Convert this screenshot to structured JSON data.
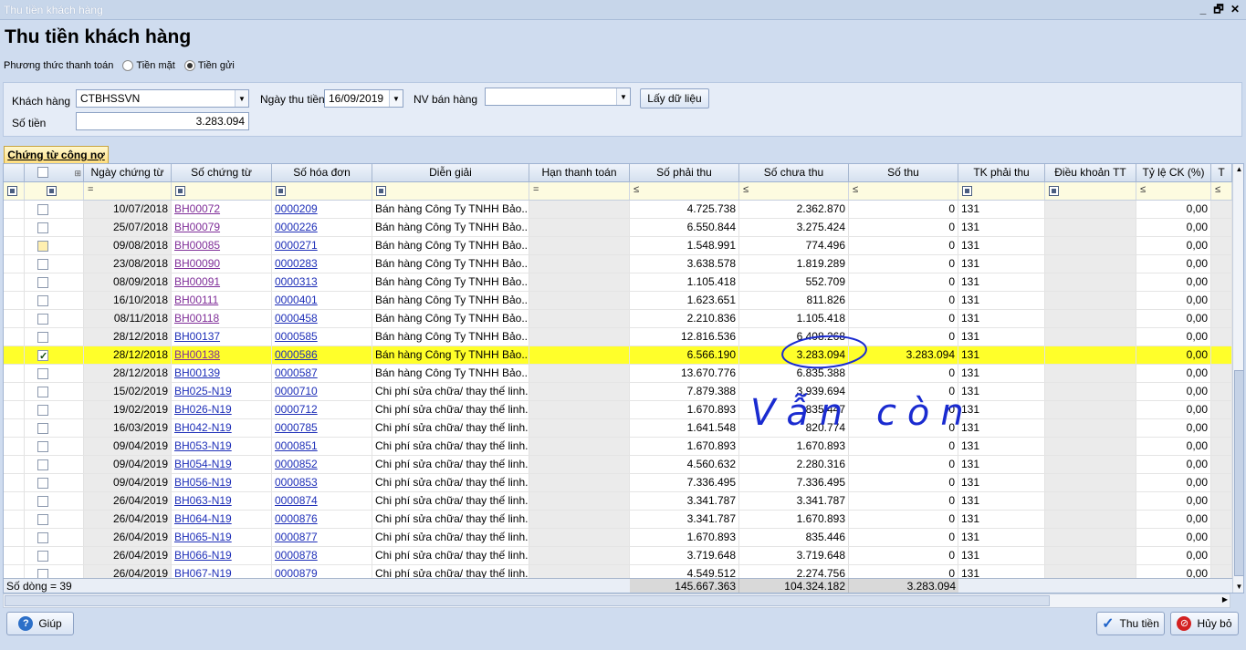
{
  "window": {
    "title": "Thu tiền khách hàng",
    "minimize": "_",
    "restore": "🗗",
    "close": "✕"
  },
  "page_title": "Thu tiền khách hàng",
  "payment": {
    "label": "Phương thức thanh toán",
    "opt_cash": "Tiền mặt",
    "opt_bank": "Tiền gửi",
    "selected": "Tiền gửi"
  },
  "filter": {
    "customer_label": "Khách hàng",
    "customer_value": "CTBHSSVN",
    "date_label": "Ngày thu tiền",
    "date_value": "16/09/2019",
    "staff_label": "NV bán hàng",
    "staff_value": "",
    "get_button": "Lấy dữ liệu",
    "amount_label": "Số tiền",
    "amount_value": "3.283.094"
  },
  "tab": "Chứng từ công nợ",
  "columns": [
    "Ngày chứng từ",
    "Số chứng từ",
    "Số hóa đơn",
    "Diễn giải",
    "Hạn thanh toán",
    "Số phải thu",
    "Số chưa thu",
    "Số thu",
    "TK phải thu",
    "Điều khoản TT",
    "Tỷ lệ CK (%)",
    "T"
  ],
  "filter_ops": {
    "eq": "=",
    "le": "≤"
  },
  "rows": [
    {
      "date": "10/07/2018",
      "doc": "BH00072",
      "inv": "0000209",
      "desc": "Bán hàng Công Ty TNHH Bảo...",
      "due": "4.725.738",
      "unpaid": "2.362.870",
      "paid": "0",
      "acc": "131",
      "rate": "0,00",
      "checked": false,
      "sel": false,
      "visited": true
    },
    {
      "date": "25/07/2018",
      "doc": "BH00079",
      "inv": "0000226",
      "desc": "Bán hàng Công Ty TNHH Bảo...",
      "due": "6.550.844",
      "unpaid": "3.275.424",
      "paid": "0",
      "acc": "131",
      "rate": "0,00",
      "checked": false,
      "sel": false,
      "visited": true
    },
    {
      "date": "09/08/2018",
      "doc": "BH00085",
      "inv": "0000271",
      "desc": "Bán hàng Công Ty TNHH Bảo...",
      "due": "1.548.991",
      "unpaid": "774.496",
      "paid": "0",
      "acc": "131",
      "rate": "0,00",
      "checked": false,
      "sel": false,
      "visited": true,
      "cb_yellow": true
    },
    {
      "date": "23/08/2018",
      "doc": "BH00090",
      "inv": "0000283",
      "desc": "Bán hàng Công Ty TNHH Bảo...",
      "due": "3.638.578",
      "unpaid": "1.819.289",
      "paid": "0",
      "acc": "131",
      "rate": "0,00",
      "checked": false,
      "sel": false,
      "visited": true
    },
    {
      "date": "08/09/2018",
      "doc": "BH00091",
      "inv": "0000313",
      "desc": "Bán hàng Công Ty TNHH Bảo...",
      "due": "1.105.418",
      "unpaid": "552.709",
      "paid": "0",
      "acc": "131",
      "rate": "0,00",
      "checked": false,
      "sel": false,
      "visited": true
    },
    {
      "date": "16/10/2018",
      "doc": "BH00111",
      "inv": "0000401",
      "desc": "Bán hàng Công Ty TNHH Bảo...",
      "due": "1.623.651",
      "unpaid": "811.826",
      "paid": "0",
      "acc": "131",
      "rate": "0,00",
      "checked": false,
      "sel": false,
      "visited": true
    },
    {
      "date": "08/11/2018",
      "doc": "BH00118",
      "inv": "0000458",
      "desc": "Bán hàng Công Ty TNHH Bảo...",
      "due": "2.210.836",
      "unpaid": "1.105.418",
      "paid": "0",
      "acc": "131",
      "rate": "0,00",
      "checked": false,
      "sel": false,
      "visited": true
    },
    {
      "date": "28/12/2018",
      "doc": "BH00137",
      "inv": "0000585",
      "desc": "Bán hàng Công Ty TNHH Bảo...",
      "due": "12.816.536",
      "unpaid": "6.408.268",
      "paid": "0",
      "acc": "131",
      "rate": "0,00",
      "checked": false,
      "sel": false,
      "visited": false
    },
    {
      "date": "28/12/2018",
      "doc": "BH00138",
      "inv": "0000586",
      "desc": "Bán hàng Công Ty TNHH Bảo...",
      "due": "6.566.190",
      "unpaid": "3.283.094",
      "paid": "3.283.094",
      "acc": "131",
      "rate": "0,00",
      "checked": true,
      "sel": true,
      "visited": true
    },
    {
      "date": "28/12/2018",
      "doc": "BH00139",
      "inv": "0000587",
      "desc": "Bán hàng Công Ty TNHH Bảo...",
      "due": "13.670.776",
      "unpaid": "6.835.388",
      "paid": "0",
      "acc": "131",
      "rate": "0,00",
      "checked": false,
      "sel": false,
      "visited": false
    },
    {
      "date": "15/02/2019",
      "doc": "BH025-N19",
      "inv": "0000710",
      "desc": "Chi phí sửa chữa/ thay thế linh...",
      "due": "7.879.388",
      "unpaid": "3.939.694",
      "paid": "0",
      "acc": "131",
      "rate": "0,00",
      "checked": false,
      "sel": false,
      "visited": false
    },
    {
      "date": "19/02/2019",
      "doc": "BH026-N19",
      "inv": "0000712",
      "desc": "Chi phí sửa chữa/ thay thế linh...",
      "due": "1.670.893",
      "unpaid": "835.447",
      "paid": "0",
      "acc": "131",
      "rate": "0,00",
      "checked": false,
      "sel": false,
      "visited": false
    },
    {
      "date": "16/03/2019",
      "doc": "BH042-N19",
      "inv": "0000785",
      "desc": "Chi phí sửa chữa/ thay thế linh...",
      "due": "1.641.548",
      "unpaid": "820.774",
      "paid": "0",
      "acc": "131",
      "rate": "0,00",
      "checked": false,
      "sel": false,
      "visited": false
    },
    {
      "date": "09/04/2019",
      "doc": "BH053-N19",
      "inv": "0000851",
      "desc": "Chi phí sửa chữa/ thay thế linh...",
      "due": "1.670.893",
      "unpaid": "1.670.893",
      "paid": "0",
      "acc": "131",
      "rate": "0,00",
      "checked": false,
      "sel": false,
      "visited": false
    },
    {
      "date": "09/04/2019",
      "doc": "BH054-N19",
      "inv": "0000852",
      "desc": "Chi phí sửa chữa/ thay thế linh...",
      "due": "4.560.632",
      "unpaid": "2.280.316",
      "paid": "0",
      "acc": "131",
      "rate": "0,00",
      "checked": false,
      "sel": false,
      "visited": false
    },
    {
      "date": "09/04/2019",
      "doc": "BH056-N19",
      "inv": "0000853",
      "desc": "Chi phí sửa chữa/ thay thế linh...",
      "due": "7.336.495",
      "unpaid": "7.336.495",
      "paid": "0",
      "acc": "131",
      "rate": "0,00",
      "checked": false,
      "sel": false,
      "visited": false
    },
    {
      "date": "26/04/2019",
      "doc": "BH063-N19",
      "inv": "0000874",
      "desc": "Chi phí sửa chữa/ thay thế linh...",
      "due": "3.341.787",
      "unpaid": "3.341.787",
      "paid": "0",
      "acc": "131",
      "rate": "0,00",
      "checked": false,
      "sel": false,
      "visited": false
    },
    {
      "date": "26/04/2019",
      "doc": "BH064-N19",
      "inv": "0000876",
      "desc": "Chi phí sửa chữa/ thay thế linh...",
      "due": "3.341.787",
      "unpaid": "1.670.893",
      "paid": "0",
      "acc": "131",
      "rate": "0,00",
      "checked": false,
      "sel": false,
      "visited": false
    },
    {
      "date": "26/04/2019",
      "doc": "BH065-N19",
      "inv": "0000877",
      "desc": "Chi phí sửa chữa/ thay thế linh...",
      "due": "1.670.893",
      "unpaid": "835.446",
      "paid": "0",
      "acc": "131",
      "rate": "0,00",
      "checked": false,
      "sel": false,
      "visited": false
    },
    {
      "date": "26/04/2019",
      "doc": "BH066-N19",
      "inv": "0000878",
      "desc": "Chi phí sửa chữa/ thay thế linh...",
      "due": "3.719.648",
      "unpaid": "3.719.648",
      "paid": "0",
      "acc": "131",
      "rate": "0,00",
      "checked": false,
      "sel": false,
      "visited": false
    },
    {
      "date": "26/04/2019",
      "doc": "BH067-N19",
      "inv": "0000879",
      "desc": "Chi phí sửa chữa/ thay thế linh...",
      "due": "4.549.512",
      "unpaid": "2.274.756",
      "paid": "0",
      "acc": "131",
      "rate": "0,00",
      "checked": false,
      "sel": false,
      "visited": false
    }
  ],
  "footer": {
    "row_count": "Số dòng = 39",
    "total_due": "145.667.363",
    "total_unpaid": "104.324.182",
    "total_paid": "3.283.094"
  },
  "buttons": {
    "help": "Giúp",
    "collect": "Thu tiền",
    "cancel": "Hủy bỏ"
  },
  "annotation": {
    "text": "Vẫn còn",
    "color": "#1a2bd0"
  }
}
